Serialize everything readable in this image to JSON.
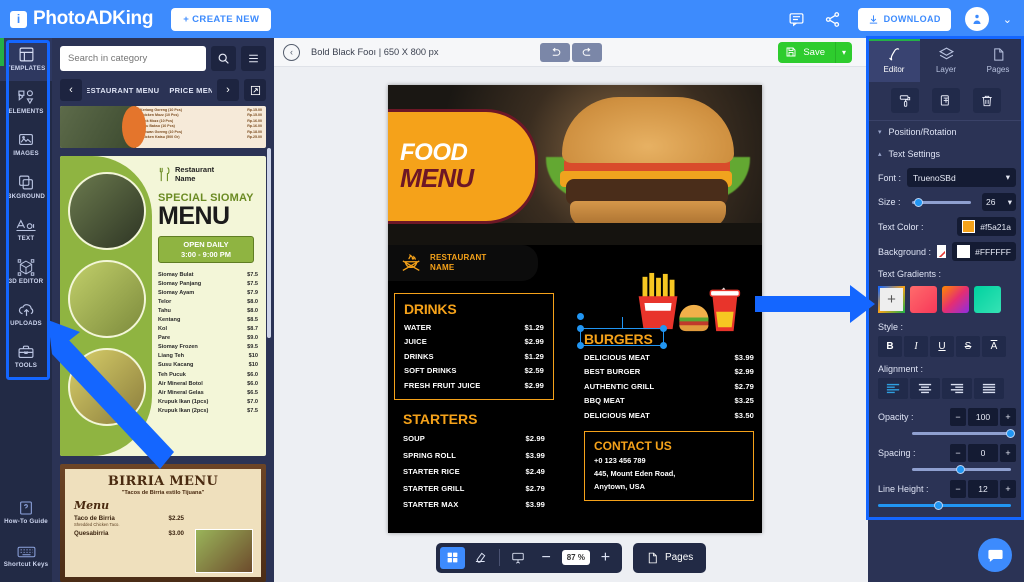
{
  "header": {
    "logo_text": "PhotoADKing",
    "logo_icon": "info-badge-icon",
    "create_new_label": "+ CREATE NEW",
    "feedback_icon": "comment-icon",
    "share_icon": "share-icon",
    "download_label": "DOWNLOAD",
    "download_icon": "download-icon",
    "avatar_icon": "user-avatar",
    "chevron": "⌄"
  },
  "rail": {
    "items": [
      {
        "label": "TEMPLATES",
        "icon": "templates-icon"
      },
      {
        "label": "ELEMENTS",
        "icon": "elements-icon"
      },
      {
        "label": "IMAGES",
        "icon": "images-icon"
      },
      {
        "label": "BKGROUND",
        "icon": "background-icon"
      },
      {
        "label": "TEXT",
        "icon": "text-icon"
      },
      {
        "label": "3D EDITOR",
        "icon": "cube-3d-icon"
      },
      {
        "label": "UPLOADS",
        "icon": "upload-cloud-icon"
      },
      {
        "label": "TOOLS",
        "icon": "toolbox-icon"
      }
    ],
    "bottom": [
      {
        "label": "How-To Guide",
        "icon": "question-book-icon"
      },
      {
        "label": "Shortcut Keys",
        "icon": "keyboard-icon"
      }
    ]
  },
  "template_panel": {
    "search_placeholder": "Search in category",
    "search_value": "",
    "search_icon": "search-icon",
    "list_icon": "list-view-icon",
    "prev_arrow": "‹",
    "next_arrow": "›",
    "expand_icon": "expand-icon",
    "categories": [
      "RESTAURANT MENU",
      "PRICE MENU"
    ],
    "templates": [
      {
        "name": "indonesian-price-list",
        "rows": [
          {
            "item": "Keriang Goreng (10 Pcs)",
            "price": "Rp.15.00"
          },
          {
            "item": "Chicken Mozz (10 Pcs)",
            "price": "Rp.15.00"
          },
          {
            "item": "Stick Mozz (10 Pcs)",
            "price": "Rp.16.00"
          },
          {
            "item": "Tahu Bakso (10 Pcs)",
            "price": "Rp.16.00"
          },
          {
            "item": "Bakwan Goreng (10 Pcs)",
            "price": "Rp.18.00"
          },
          {
            "item": "Chicken Katsu (500 Gr)",
            "price": "Rp.25.00"
          }
        ]
      },
      {
        "name": "special-siomay-menu",
        "brand": "Restaurant\nName",
        "brand_line1": "Restaurant",
        "brand_line2": "Name",
        "brand_icon": "fork-knife-icon",
        "special": "SPECIAL SIOMAY",
        "menu_word": "MENU",
        "open_label": "OPEN DAILY",
        "open_hours": "3:00 - 9:00 PM",
        "items": [
          {
            "item": "Siomay Bulat",
            "price": "$7.5"
          },
          {
            "item": "Siomay Panjang",
            "price": "$7.5"
          },
          {
            "item": "Siomay Ayam",
            "price": "$7.9"
          },
          {
            "item": "Telor",
            "price": "$8.0"
          },
          {
            "item": "Tahu",
            "price": "$8.0"
          },
          {
            "item": "Kentang",
            "price": "$8.5"
          },
          {
            "item": "Kol",
            "price": "$8.7"
          },
          {
            "item": "Pare",
            "price": "$9.0"
          },
          {
            "item": "Siomay Frozen",
            "price": "$9.5"
          },
          {
            "item": "Liang Teh",
            "price": "$10"
          },
          {
            "item": "Susu Kacang",
            "price": "$10"
          },
          {
            "item": "Teh Pucuk",
            "price": "$6.0"
          },
          {
            "item": "Air Mineral Botol",
            "price": "$6.0"
          },
          {
            "item": "Air Mineral Gelas",
            "price": "$6.5"
          },
          {
            "item": "Krupuk Ikan (1pcs)",
            "price": "$7.0"
          },
          {
            "item": "Krupuk Ikan (2pcs)",
            "price": "$7.5"
          }
        ]
      },
      {
        "name": "birria-menu",
        "title": "BIRRIA MENU",
        "subtitle": "\"Tacos de Birria estilo Tijuana\"",
        "menu_word": "Menu",
        "items": [
          {
            "item": "Taco de Birria",
            "price": "$2.25",
            "desc": "Shredded Chicken Taco."
          },
          {
            "item": "Quesabirria",
            "price": "$3.00",
            "desc": ""
          }
        ]
      }
    ]
  },
  "canvas_bar": {
    "back_icon": "back-circle-icon",
    "doc_title": "Bold Black Fooı | 650 X 800 px",
    "undo_icon": "undo-icon",
    "redo_icon": "redo-icon",
    "save_label": "Save",
    "save_icon": "save-disk-icon",
    "save_chevron": "▾",
    "info_icon": "info-circle-icon"
  },
  "design": {
    "food_word": "FOOD",
    "menu_word": "MENU",
    "restaurant_line1": "RESTAURANT",
    "restaurant_line2": "NAME",
    "restaurant_icon": "crossed-utensils-flame-icon",
    "combo_icon": "fries-burger-drink-icon",
    "drinks": {
      "heading": "DRINKS",
      "items": [
        {
          "item": "WATER",
          "price": "$1.29"
        },
        {
          "item": "JUICE",
          "price": "$2.99"
        },
        {
          "item": "DRINKS",
          "price": "$1.29"
        },
        {
          "item": "SOFT DRINKS",
          "price": "$2.59"
        },
        {
          "item": "FRESH FRUIT JUICE",
          "price": "$2.99"
        }
      ]
    },
    "starters": {
      "heading": "STARTERS",
      "items": [
        {
          "item": "SOUP",
          "price": "$2.99"
        },
        {
          "item": "SPRING ROLL",
          "price": "$3.99"
        },
        {
          "item": "STARTER RICE",
          "price": "$2.49"
        },
        {
          "item": "STARTER GRILL",
          "price": "$2.79"
        },
        {
          "item": "STARTER MAX",
          "price": "$3.99"
        }
      ]
    },
    "burgers": {
      "heading": "BURGERS",
      "items": [
        {
          "item": "DELICIOUS MEAT",
          "price": "$3.99"
        },
        {
          "item": "BEST BURGER",
          "price": "$2.99"
        },
        {
          "item": "AUTHENTIC GRILL",
          "price": "$2.79"
        },
        {
          "item": "BBQ MEAT",
          "price": "$3.25"
        },
        {
          "item": "DELICIOUS MEAT",
          "price": "$3.50"
        }
      ]
    },
    "contact": {
      "heading": "CONTACT US",
      "phone": "+0 123 456 789",
      "address_line1": "445, Mount Eden Road,",
      "address_line2": "Anytown, USA"
    },
    "accent_color": "#f5a21a",
    "dark_color": "#6d1726"
  },
  "bottom_bar": {
    "grid_icon": "grid-view-icon",
    "eraser_icon": "eraser-icon",
    "present_icon": "presentation-icon",
    "minus": "−",
    "zoom_value": "87 %",
    "plus": "+",
    "pages_label": "Pages",
    "pages_icon": "page-icon"
  },
  "right_panel": {
    "tabs": [
      {
        "label": "Editor",
        "icon": "editor-pen-icon",
        "active": true
      },
      {
        "label": "Layer",
        "icon": "layers-icon",
        "active": false
      },
      {
        "label": "Pages",
        "icon": "page-icon",
        "active": false
      }
    ],
    "tools": [
      {
        "name": "paint-roller-icon"
      },
      {
        "name": "duplicate-icon"
      },
      {
        "name": "trash-icon"
      }
    ],
    "sections": [
      {
        "label": "Position/Rotation",
        "expanded": false,
        "caret": "▾"
      },
      {
        "label": "Text Settings",
        "expanded": true,
        "caret": "▴"
      }
    ],
    "font_label": "Font :",
    "font_value": "TruenoSBd",
    "size_label": "Size :",
    "size_value": "26",
    "text_color_label": "Text Color :",
    "text_color_value": "#f5a21a",
    "background_label": "Background :",
    "background_none_icon": "no-color-icon",
    "background_value": "#FFFFFF",
    "gradients_label": "Text Gradients :",
    "gradient_add": "+",
    "gradients": [
      {
        "name": "gradient-add",
        "css": "add"
      },
      {
        "name": "gradient-pink-red",
        "css": "linear-gradient(135deg,#ff6b6b,#f73859)"
      },
      {
        "name": "gradient-orange-magenta",
        "css": "linear-gradient(135deg,#ff8a00,#e52e71,#8e2de2)"
      },
      {
        "name": "gradient-teal-green",
        "css": "linear-gradient(135deg,#00d2a0,#36e2b4)"
      }
    ],
    "style_label": "Style :",
    "styles": [
      {
        "name": "bold-button",
        "glyph": "B"
      },
      {
        "name": "italic-button",
        "glyph": "I"
      },
      {
        "name": "underline-button",
        "glyph": "U"
      },
      {
        "name": "strikethrough-button",
        "glyph": "S"
      },
      {
        "name": "overline-button",
        "glyph": "A"
      }
    ],
    "alignment_label": "Alignment :",
    "alignments": [
      {
        "name": "align-left-button",
        "active": true
      },
      {
        "name": "align-center-button",
        "active": false
      },
      {
        "name": "align-right-button",
        "active": false
      },
      {
        "name": "align-justify-button",
        "active": false
      }
    ],
    "opacity_label": "Opacity :",
    "opacity_value": "100",
    "spacing_label": "Spacing :",
    "spacing_value": "0",
    "line_height_label": "Line Height :",
    "line_height_value": "12",
    "minus": "−",
    "plus": "+",
    "chat_icon": "chat-bubble-icon"
  }
}
